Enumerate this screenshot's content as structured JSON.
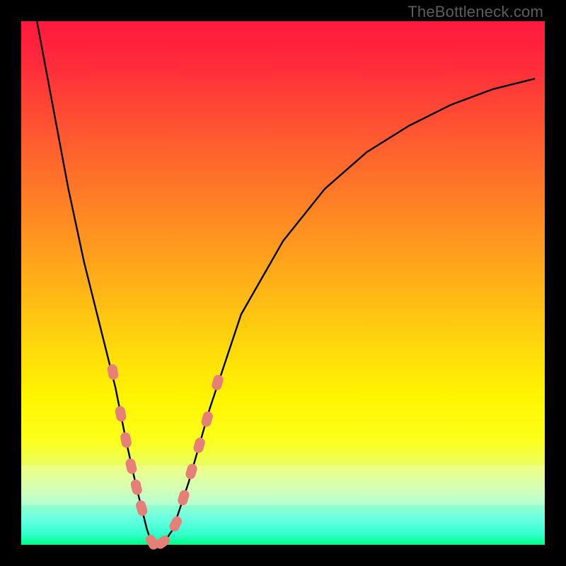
{
  "watermark": "TheBottleneck.com",
  "colors": {
    "frame": "#000000",
    "curve": "#000000",
    "marker_fill": "#e77f79",
    "gradient_top": "#ff193f",
    "gradient_bottom": "#00ff85"
  },
  "chart_data": {
    "type": "line",
    "title": "",
    "xlabel": "",
    "ylabel": "",
    "xlim": [
      0,
      100
    ],
    "ylim": [
      0,
      100
    ],
    "grid": false,
    "legend": false,
    "note": "V-shaped bottleneck curve; y≈0 at trough, rises steeply on both sides. Values are estimated from pixel positions (no axis ticks present).",
    "series": [
      {
        "name": "bottleneck-curve",
        "x": [
          3,
          6,
          9,
          12,
          15,
          18,
          20,
          22,
          24,
          25,
          27,
          29,
          32,
          36,
          42,
          50,
          58,
          66,
          74,
          82,
          90,
          98
        ],
        "y": [
          100,
          84,
          68,
          54,
          42,
          30,
          20,
          11,
          3,
          0,
          0,
          3,
          12,
          26,
          44,
          58,
          68,
          75,
          80,
          84,
          87,
          89
        ]
      }
    ],
    "markers": {
      "name": "highlighted-segments",
      "note": "Salmon pill-shaped markers along lower portion of both arms of the V",
      "points": [
        {
          "x": 17.5,
          "y": 33
        },
        {
          "x": 19.0,
          "y": 25
        },
        {
          "x": 20.0,
          "y": 20
        },
        {
          "x": 21.0,
          "y": 15
        },
        {
          "x": 22.0,
          "y": 11
        },
        {
          "x": 23.0,
          "y": 7
        },
        {
          "x": 25.0,
          "y": 0.5
        },
        {
          "x": 27.0,
          "y": 0.5
        },
        {
          "x": 29.5,
          "y": 4
        },
        {
          "x": 31.0,
          "y": 9
        },
        {
          "x": 32.5,
          "y": 14
        },
        {
          "x": 34.0,
          "y": 19
        },
        {
          "x": 35.5,
          "y": 24
        },
        {
          "x": 37.5,
          "y": 31
        }
      ]
    }
  }
}
